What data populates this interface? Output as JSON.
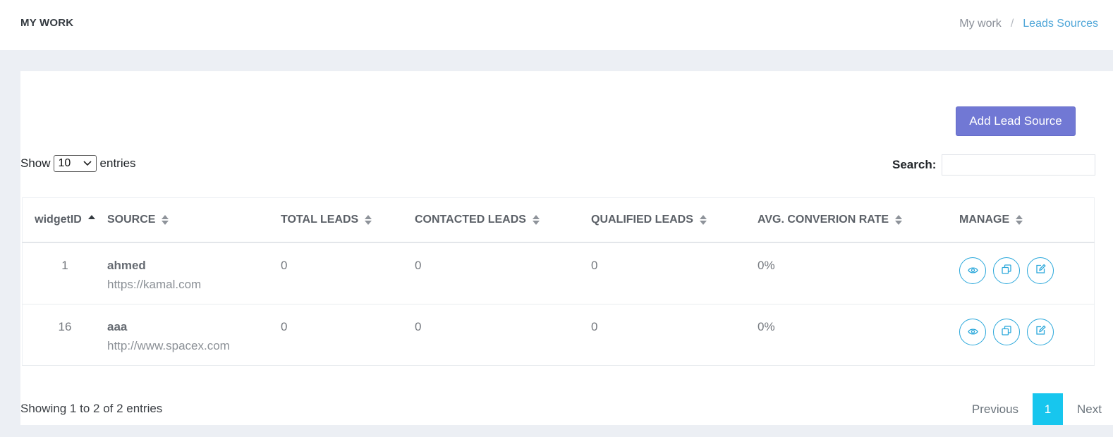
{
  "header": {
    "title": "MY WORK",
    "breadcrumb": {
      "parent": "My work",
      "separator": "/",
      "current": "Leads Sources"
    }
  },
  "toolbar": {
    "add_label": "Add Lead Source"
  },
  "length": {
    "prefix": "Show",
    "value": "10",
    "suffix": "entries"
  },
  "search": {
    "label": "Search:",
    "value": ""
  },
  "table": {
    "columns": [
      "widgetID",
      "SOURCE",
      "TOTAL LEADS",
      "CONTACTED LEADS",
      "QUALIFIED LEADS",
      "AVG. CONVERION RATE",
      "MANAGE"
    ],
    "rows": [
      {
        "id": "1",
        "name": "ahmed",
        "url": "https://kamal.com",
        "total": "0",
        "contacted": "0",
        "qualified": "0",
        "rate": "0%"
      },
      {
        "id": "16",
        "name": "aaa",
        "url": "http://www.spacex.com",
        "total": "0",
        "contacted": "0",
        "qualified": "0",
        "rate": "0%"
      }
    ]
  },
  "footer": {
    "info": "Showing 1 to 2 of 2 entries",
    "pagination": {
      "previous": "Previous",
      "current": "1",
      "next": "Next"
    }
  },
  "icons": {
    "view": "eye-icon",
    "copy": "copy-icon",
    "edit": "edit-icon"
  },
  "colors": {
    "accent": "#7178d4",
    "info": "#2ba8db",
    "page_active": "#17c6ee",
    "link": "#4fa6d8"
  }
}
